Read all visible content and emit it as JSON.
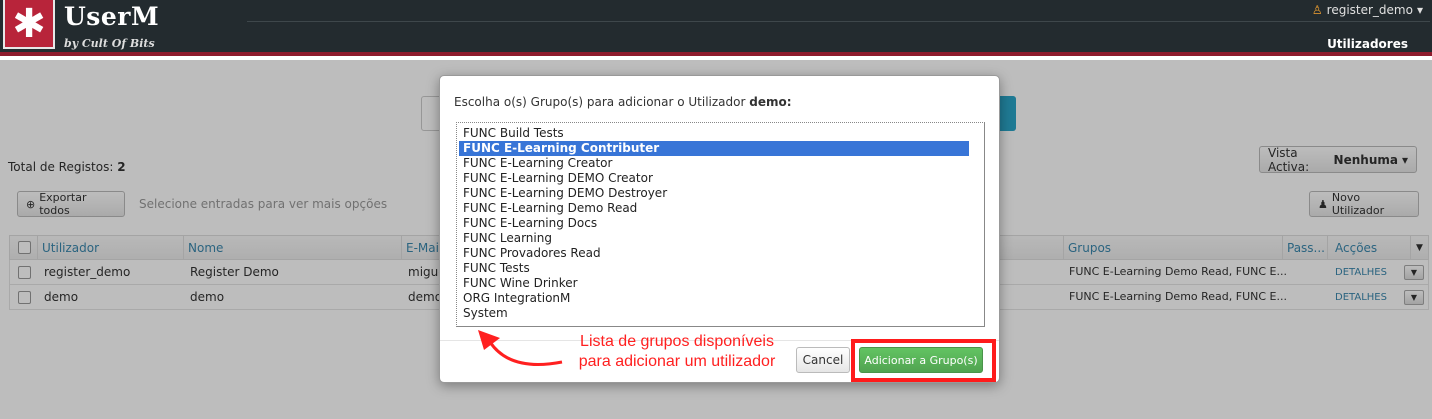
{
  "app": {
    "title": "UserM",
    "subtitle": "by Cult Of Bits",
    "user_menu": "register_demo",
    "nav_item": "Utilizadores"
  },
  "toolbar": {
    "total_label": "Total de Registos:",
    "total_value": "2",
    "vista_label": "Vista Activa:",
    "vista_value": "Nenhuma",
    "export_label": "Exportar todos",
    "hint": "Selecione entradas para ver mais opções",
    "new_user_label": "Novo Utilizador"
  },
  "table": {
    "headers": {
      "utilizador": "Utilizador",
      "nome": "Nome",
      "email": "E-Mail",
      "grupos": "Grupos",
      "pass": "Pass...",
      "accoes": "Acções"
    },
    "rows": [
      {
        "utilizador": "register_demo",
        "nome": "Register Demo",
        "email": "migue",
        "grupos": "FUNC E-Learning Demo Read, FUNC E...",
        "accao": "DETALHES"
      },
      {
        "utilizador": "demo",
        "nome": "demo",
        "email": "demo",
        "grupos": "FUNC E-Learning Demo Read, FUNC E...",
        "accao": "DETALHES"
      }
    ]
  },
  "modal": {
    "title_prefix": "Escolha o(s) Grupo(s) para adicionar o Utilizador",
    "title_user": "demo:",
    "options": [
      "FUNC Build Tests",
      "FUNC E-Learning Contributer",
      "FUNC E-Learning Creator",
      "FUNC E-Learning DEMO Creator",
      "FUNC E-Learning DEMO Destroyer",
      "FUNC E-Learning Demo Read",
      "FUNC E-Learning Docs",
      "FUNC Learning",
      "FUNC Provadores Read",
      "FUNC Tests",
      "FUNC Wine Drinker",
      "ORG IntegrationM",
      "System"
    ],
    "selected_index": 1,
    "cancel_label": "Cancel",
    "add_label": "Adicionar a Grupo(s)"
  },
  "annotation": {
    "line1": "Lista de grupos disponíveis",
    "line2": "para adicionar um utilizador",
    "color": "#ff2020"
  }
}
